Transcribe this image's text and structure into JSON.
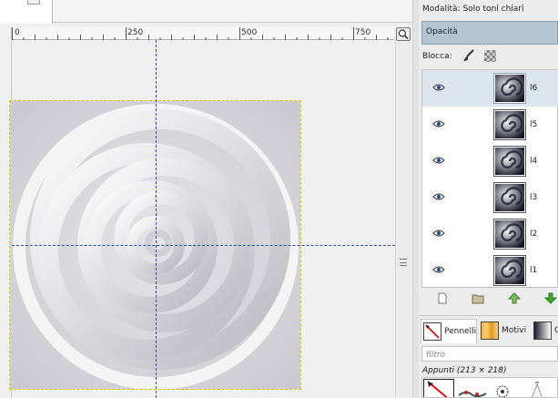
{
  "ruler": {
    "ticks": [
      "0",
      "250",
      "500",
      "750"
    ]
  },
  "layers_panel": {
    "mode_label": "Modalità:",
    "mode_value": "Solo toni chiari",
    "opacity_label": "Opacità",
    "lock_label": "Blocca:",
    "layers": [
      {
        "name": "l6",
        "active": true
      },
      {
        "name": "l5",
        "active": false
      },
      {
        "name": "l4",
        "active": false
      },
      {
        "name": "l3",
        "active": false
      },
      {
        "name": "l2",
        "active": false
      },
      {
        "name": "l1",
        "active": false
      }
    ]
  },
  "brushes_panel": {
    "tabs": [
      {
        "label": "Pennelli",
        "icon": "brush-tab-icon"
      },
      {
        "label": "Motivi",
        "icon": "pattern-tab-icon"
      },
      {
        "label": "G",
        "icon": "gradient-tab-icon"
      }
    ],
    "filter_placeholder": "filtro",
    "selected_brush": "Appunti (213 × 218)"
  },
  "colors": {
    "selection_bar": "#b4c4d2",
    "guide": "#2a4fb0"
  }
}
